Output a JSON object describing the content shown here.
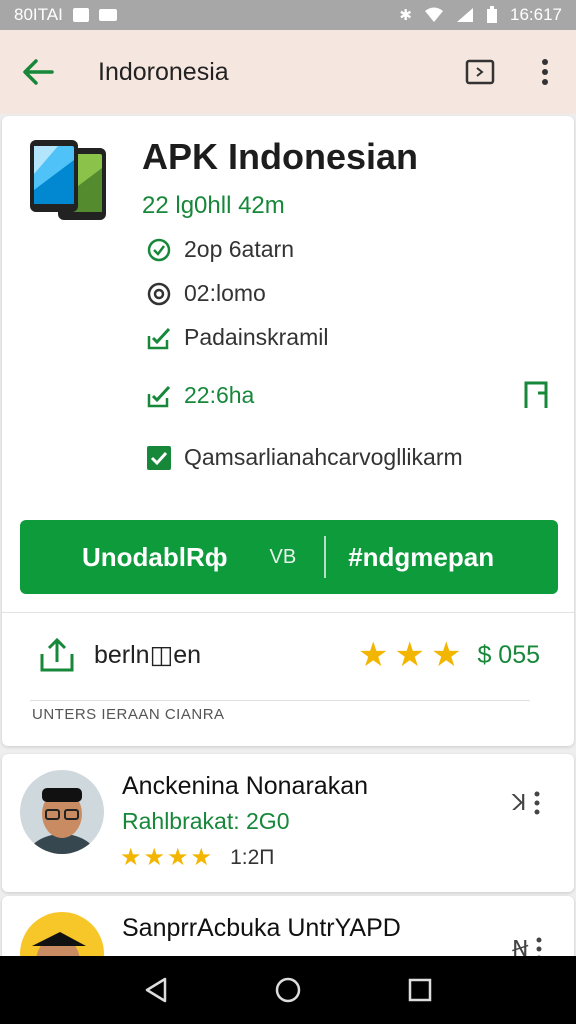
{
  "status_bar": {
    "left_text": "80ITAI",
    "time": "16:617"
  },
  "app_bar": {
    "title": "Indoronesia"
  },
  "app": {
    "name": "APK Indonesian",
    "meta": "22 lg0hll 42m",
    "info_rows": [
      {
        "icon": "verified-check-icon",
        "text": "2op 6atarn"
      },
      {
        "icon": "clock-icon",
        "text": "02:lomo"
      },
      {
        "icon": "edit-check-icon",
        "text": "Padainskramil"
      },
      {
        "icon": "edit-check-icon",
        "text": "22:6ha"
      },
      {
        "icon": "checkbox-checked-icon",
        "text": "Qamsarlianahcarvogllikarm"
      }
    ]
  },
  "install": {
    "left_label": "UnodablRф",
    "mid_label": "VB",
    "right_label": "#ndgmepan"
  },
  "actions": {
    "share_label": "berln◫en",
    "rating_stars": 3,
    "rating_value": "$ 055"
  },
  "footer_label": "UNTERS IERAAN CIANRA",
  "reviews": [
    {
      "name": "Anckenina Nonarakan",
      "sub": "Rahlbrakat: 2G0",
      "stars": 4,
      "time": "1:2П"
    },
    {
      "name": "SanprrAcbuka UntrYAPD",
      "sub": "",
      "stars": 0,
      "time": ""
    }
  ],
  "colors": {
    "accent_green": "#0d9b3c",
    "text_green": "#17873a",
    "star": "#f3b600",
    "app_bar": "#f6e6e0"
  }
}
